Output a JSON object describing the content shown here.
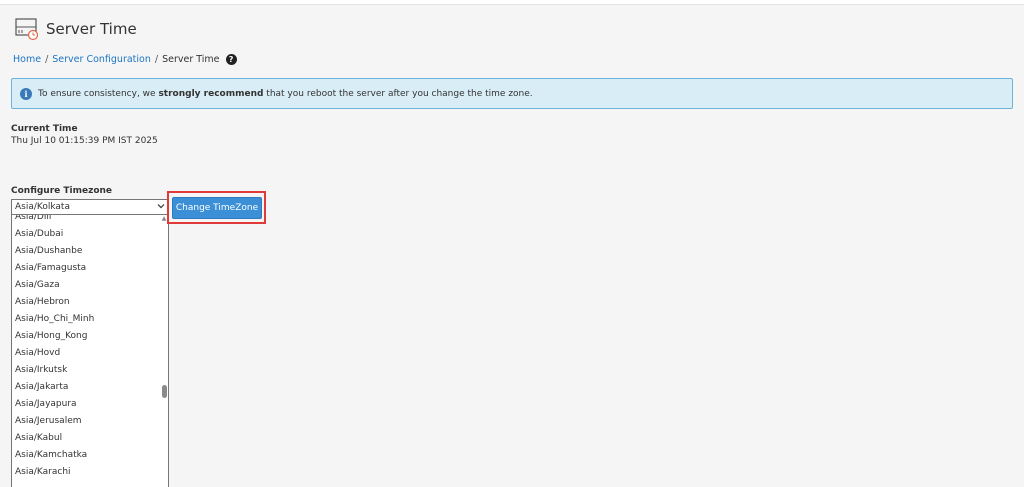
{
  "header": {
    "icon": "server-time-icon",
    "title": "Server Time"
  },
  "breadcrumb": {
    "items": [
      "Home",
      "Server Configuration"
    ],
    "current": "Server Time",
    "help_icon": "question-circle-icon"
  },
  "alert": {
    "icon": "info-icon",
    "text_before": "To ensure consistency, we ",
    "text_bold": "strongly recommend",
    "text_after": " that you reboot the server after you change the time zone."
  },
  "current_time": {
    "label": "Current Time",
    "value": "Thu Jul 10 01:15:39 PM IST 2025"
  },
  "configure_timezone": {
    "label": "Configure Timezone",
    "selected": "Asia/Kolkata",
    "options": [
      "Asia/Dili",
      "Asia/Dubai",
      "Asia/Dushanbe",
      "Asia/Famagusta",
      "Asia/Gaza",
      "Asia/Hebron",
      "Asia/Ho_Chi_Minh",
      "Asia/Hong_Kong",
      "Asia/Hovd",
      "Asia/Irkutsk",
      "Asia/Jakarta",
      "Asia/Jayapura",
      "Asia/Jerusalem",
      "Asia/Kabul",
      "Asia/Kamchatka",
      "Asia/Karachi"
    ],
    "button_label": "Change TimeZone"
  },
  "colors": {
    "link": "#1e75c6",
    "alert_bg": "#d9edf7",
    "alert_border": "#6cb4d9",
    "button": "#3a8fd6",
    "highlight": "#e03a3a"
  }
}
